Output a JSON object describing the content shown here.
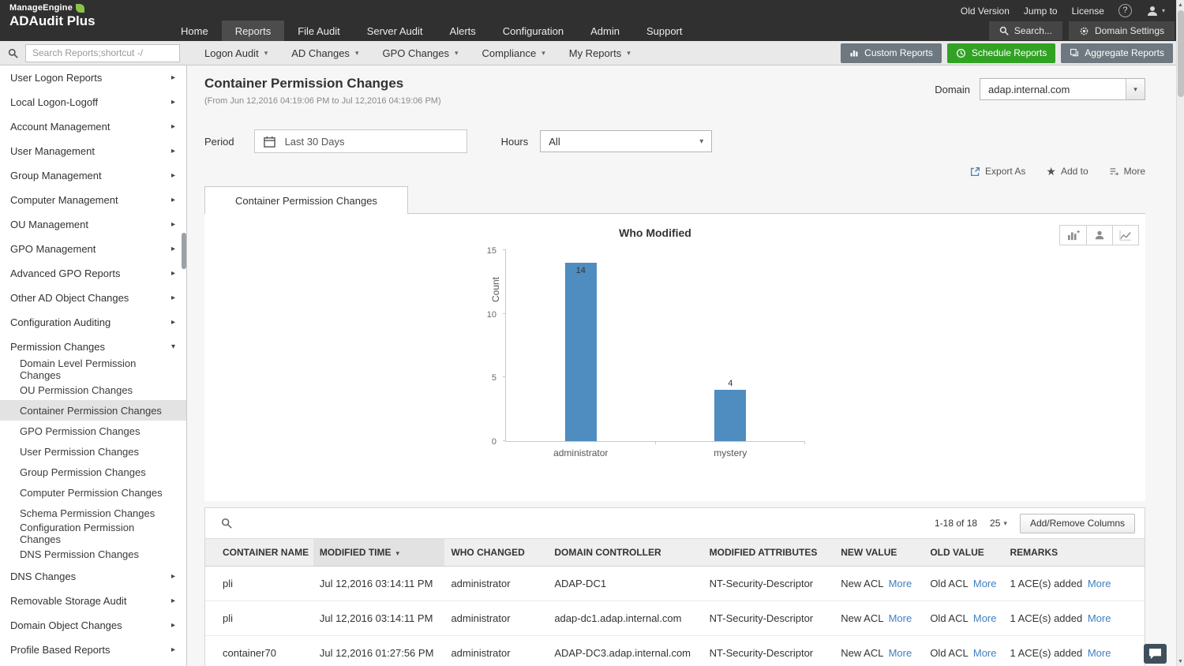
{
  "topbar": {
    "brand": {
      "manage": "ManageEngine",
      "product": "ADAudit Plus"
    },
    "utility": [
      "Old Version",
      "Jump to",
      "License"
    ],
    "nav": [
      "Home",
      "Reports",
      "File Audit",
      "Server Audit",
      "Alerts",
      "Configuration",
      "Admin",
      "Support"
    ],
    "active_nav": "Reports",
    "search_label": "Search...",
    "domain_settings_label": "Domain Settings"
  },
  "toolbar": {
    "search_placeholder": "Search Reports;shortcut -/",
    "menus": [
      "Logon Audit",
      "AD Changes",
      "GPO Changes",
      "Compliance",
      "My Reports"
    ],
    "custom_reports": "Custom Reports",
    "schedule_reports": "Schedule Reports",
    "aggregate_reports": "Aggregate Reports"
  },
  "sidebar": {
    "items": [
      {
        "label": "User Logon Reports"
      },
      {
        "label": "Local Logon-Logoff"
      },
      {
        "label": "Account Management"
      },
      {
        "label": "User Management"
      },
      {
        "label": "Group Management"
      },
      {
        "label": "Computer Management"
      },
      {
        "label": "OU Management"
      },
      {
        "label": "GPO Management"
      },
      {
        "label": "Advanced GPO Reports"
      },
      {
        "label": "Other AD Object Changes"
      },
      {
        "label": "Configuration Auditing"
      },
      {
        "label": "Permission Changes",
        "expanded": true,
        "children": [
          "Domain Level Permission Changes",
          "OU Permission Changes",
          "Container Permission Changes",
          "GPO Permission Changes",
          "User Permission Changes",
          "Group Permission Changes",
          "Computer Permission Changes",
          "Schema Permission Changes",
          "Configuration Permission Changes",
          "DNS Permission Changes"
        ],
        "selected_child": "Container Permission Changes"
      },
      {
        "label": "DNS Changes"
      },
      {
        "label": "Removable Storage Audit"
      },
      {
        "label": "Domain Object Changes"
      },
      {
        "label": "Profile Based Reports"
      }
    ]
  },
  "report": {
    "title": "Container Permission Changes",
    "date_range": "(From Jun 12,2016 04:19:06 PM to Jul 12,2016 04:19:06 PM)",
    "domain_label": "Domain",
    "domain_value": "adap.internal.com",
    "period_label": "Period",
    "period_value": "Last 30 Days",
    "hours_label": "Hours",
    "hours_value": "All",
    "export_as": "Export As",
    "add_to": "Add to",
    "more": "More",
    "tab": "Container Permission Changes"
  },
  "chart_data": {
    "type": "bar",
    "title": "Who Modified",
    "categories": [
      "administrator",
      "mystery"
    ],
    "values": [
      14,
      4
    ],
    "ylabel": "Count",
    "xlabel": "",
    "ylim": [
      0,
      15
    ],
    "yticks": [
      0,
      5,
      10,
      15
    ],
    "grid": false,
    "legend": false,
    "bar_color": "#4f8cbf"
  },
  "table": {
    "pagination": "1-18 of 18",
    "page_size": "25",
    "add_remove_columns": "Add/Remove Columns",
    "more_label": "More",
    "headers": [
      "CONTAINER NAME",
      "MODIFIED TIME",
      "WHO CHANGED",
      "DOMAIN CONTROLLER",
      "MODIFIED ATTRIBUTES",
      "NEW VALUE",
      "OLD VALUE",
      "REMARKS"
    ],
    "sorted_header": "MODIFIED TIME",
    "sort_direction": "desc",
    "rows": [
      {
        "container_name": "pli",
        "modified_time": "Jul 12,2016 03:14:11 PM",
        "who_changed": "administrator",
        "domain_controller": "ADAP-DC1",
        "modified_attributes": "NT-Security-Descriptor",
        "new_value": "New ACL",
        "old_value": "Old ACL",
        "remarks": "1 ACE(s) added"
      },
      {
        "container_name": "pli",
        "modified_time": "Jul 12,2016 03:14:11 PM",
        "who_changed": "administrator",
        "domain_controller": "adap-dc1.adap.internal.com",
        "modified_attributes": "NT-Security-Descriptor",
        "new_value": "New ACL",
        "old_value": "Old ACL",
        "remarks": "1 ACE(s) added"
      },
      {
        "container_name": "container70",
        "modified_time": "Jul 12,2016 01:27:56 PM",
        "who_changed": "administrator",
        "domain_controller": "ADAP-DC3.adap.internal.com",
        "modified_attributes": "NT-Security-Descriptor",
        "new_value": "New ACL",
        "old_value": "Old ACL",
        "remarks": "1 ACE(s) added"
      }
    ]
  },
  "colors": {
    "topbar_bg": "#303030",
    "accent_green": "#31a224",
    "link_blue": "#3f7fc1",
    "bar_blue": "#4f8cbf"
  }
}
